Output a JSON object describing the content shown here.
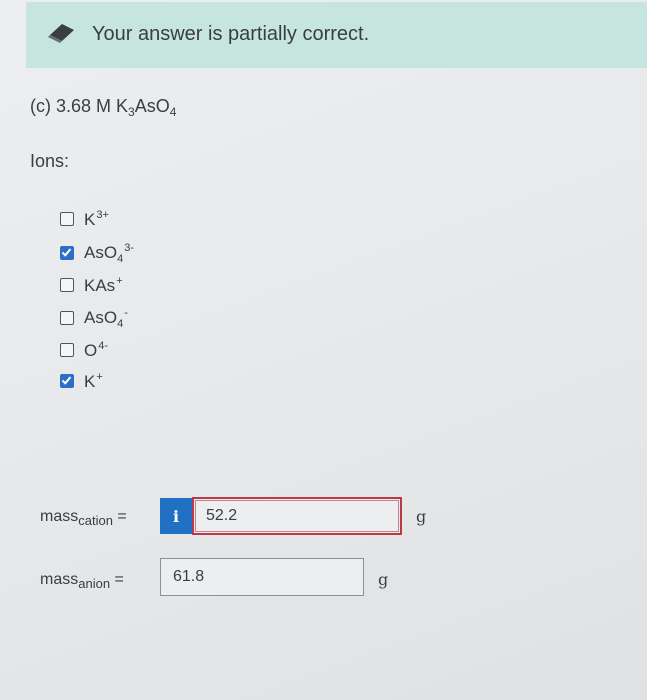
{
  "banner": {
    "text": "Your answer is partially correct.",
    "icon": "pencil-eraser-icon"
  },
  "question": {
    "prefix": "(c) 3.68 M K",
    "sub1": "3",
    "mid": "AsO",
    "sub2": "4"
  },
  "ions_label": "Ions:",
  "options": [
    {
      "base": "K",
      "sub": "",
      "sup": "3+",
      "checked": false
    },
    {
      "base": "AsO",
      "sub": "4",
      "sup": "3-",
      "checked": true
    },
    {
      "base": "KAs",
      "sub": "",
      "sup": "+",
      "checked": false
    },
    {
      "base": "AsO",
      "sub": "4",
      "sup": "-",
      "checked": false
    },
    {
      "base": "O",
      "sub": "",
      "sup": "4-",
      "checked": false
    },
    {
      "base": "K",
      "sub": "",
      "sup": "+",
      "checked": true
    }
  ],
  "mass_cation": {
    "label": "mass",
    "sub": "cation",
    "eq": " =",
    "info": "i",
    "value": "52.2",
    "unit": "g"
  },
  "mass_anion": {
    "label": "mass",
    "sub": "anion",
    "eq": " =",
    "value": "61.8",
    "unit": "g"
  },
  "colors": {
    "banner_bg": "#c5e5de",
    "check_blue": "#2c6fc6",
    "info_blue": "#2270c4",
    "error_red": "#b93a46"
  }
}
